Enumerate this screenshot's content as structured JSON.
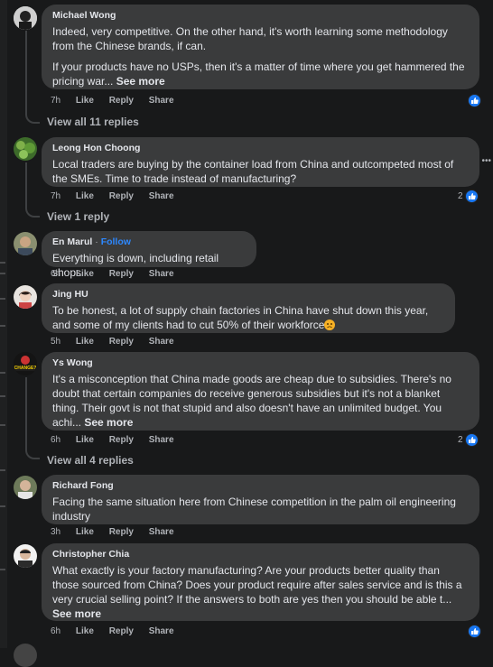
{
  "comments": [
    {
      "author": "Michael Wong",
      "paragraphs": [
        "Indeed, very competitive. On the other hand, it's worth learning some methodology from the Chinese brands, if can."
      ],
      "last_paragraph": "If your products have no USPs, then it's a matter of time where you get hammered the pricing war...",
      "see_more": "See more",
      "time": "7h",
      "like": "Like",
      "reply": "Reply",
      "share": "Share",
      "reaction_count": "",
      "view_replies": "View all 11 replies"
    },
    {
      "author": "Leong Hon Choong",
      "text": "Local traders are buying by the container load from China and outcompeted most of the SMEs. Time to trade instead of manufacturing?",
      "time": "7h",
      "like": "Like",
      "reply": "Reply",
      "share": "Share",
      "reaction_count": "2",
      "view_replies": "View 1 reply"
    },
    {
      "author": "En Marul",
      "follow_sep": "·",
      "follow": "Follow",
      "text": "Everything is down, including retail shops",
      "time": "6h",
      "like": "Like",
      "reply": "Reply",
      "share": "Share"
    },
    {
      "author": "Jing HU",
      "text": "To be honest, a lot of supply chain factories in China have shut down this year, and some of my clients had to cut 50% of their workforce",
      "time": "5h",
      "like": "Like",
      "reply": "Reply",
      "share": "Share"
    },
    {
      "author": "Ys Wong",
      "text": "It's a misconception that China made goods are cheap due to subsidies. There's no doubt that certain companies do receive generous subsidies but it's not a blanket thing. Their govt is not that stupid and also doesn't have an unlimited budget. You achi...",
      "see_more": "See more",
      "time": "6h",
      "like": "Like",
      "reply": "Reply",
      "share": "Share",
      "reaction_count": "2",
      "view_replies": "View all 4 replies",
      "avatar_text": "CHANGE?"
    },
    {
      "author": "Richard Fong",
      "text": "Facing the same situation here from Chinese competition in the palm oil engineering industry",
      "time": "3h",
      "like": "Like",
      "reply": "Reply",
      "share": "Share"
    },
    {
      "author": "Christopher Chia",
      "text": "What exactly is your factory manufacturing? Are your products better quality than those sourced from China? Does your product require after sales service and is this a very crucial selling point? If the answers to both are yes then you should be able t...",
      "see_more": "See more",
      "time": "6h",
      "like": "Like",
      "reply": "Reply",
      "share": "Share",
      "reaction_count": ""
    }
  ],
  "colors": {
    "background": "#18191a",
    "bubble": "#3a3b3c",
    "text": "#e4e6eb",
    "secondary_text": "#b0b3b8",
    "like_blue": "#1877f2",
    "follow_blue": "#2d88ff"
  },
  "icons": [
    "like-reaction-icon",
    "more-options-icon",
    "emoji-worried-icon"
  ]
}
